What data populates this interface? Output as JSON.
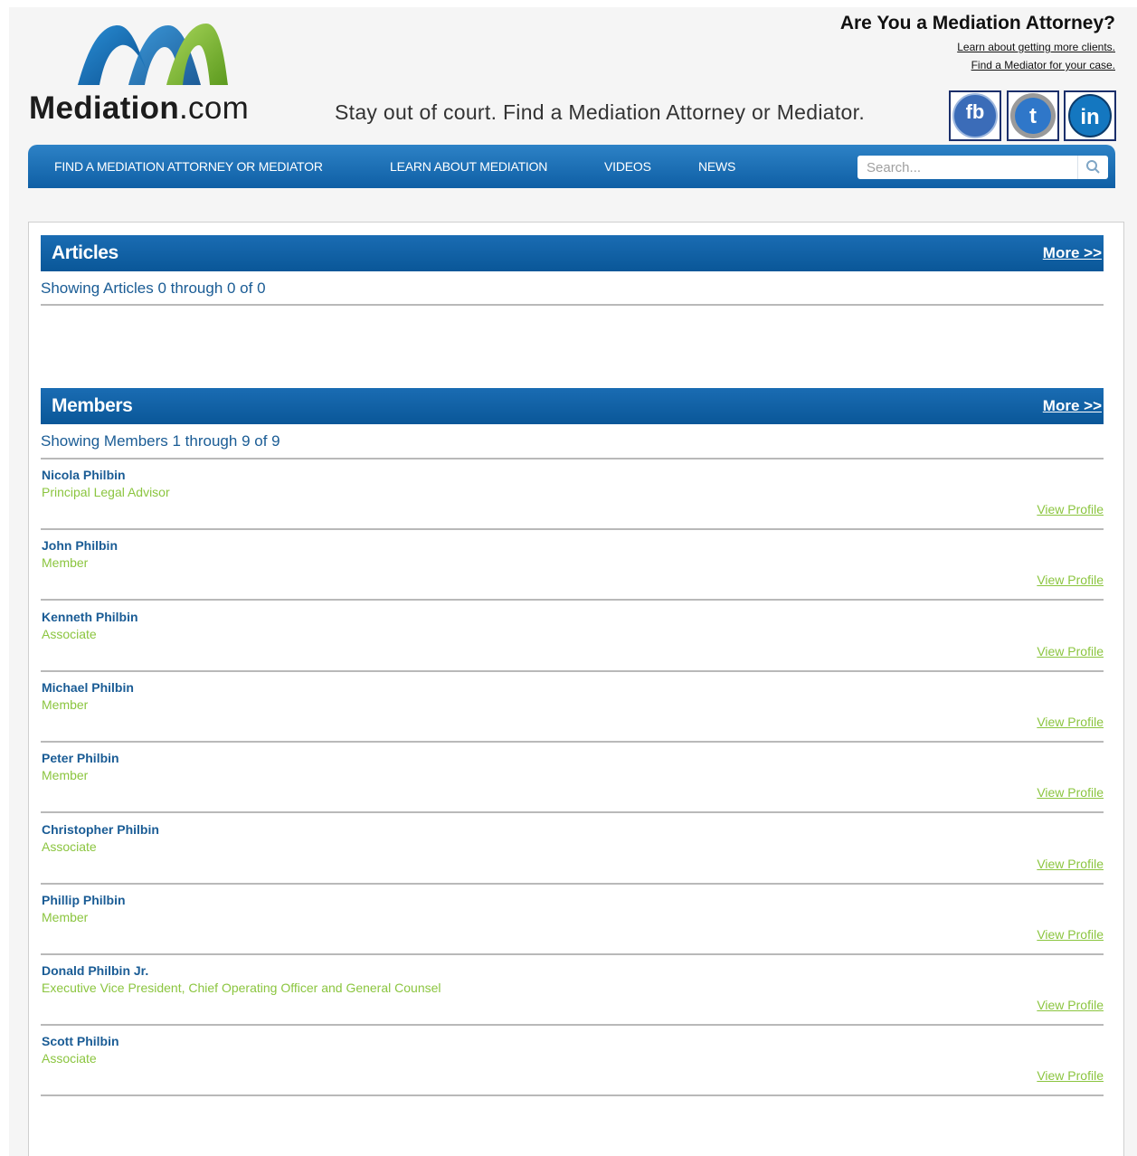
{
  "header": {
    "logo_bold": "Mediation",
    "logo_light": ".com",
    "tagline": "Stay out of court. Find a Mediation Attorney or Mediator.",
    "promo_title": "Are You a Mediation Attorney?",
    "promo_links": [
      "Learn about getting more clients.",
      "Find a Mediator for your case."
    ],
    "social": [
      "facebook-icon",
      "twitter-icon",
      "linkedin-icon"
    ],
    "brand_blue": "#1a6cb3",
    "brand_green": "#8bc53f"
  },
  "nav": {
    "items": [
      "FIND A MEDIATION ATTORNEY OR MEDIATOR",
      "LEARN ABOUT MEDIATION",
      "VIDEOS",
      "NEWS"
    ],
    "search_placeholder": "Search..."
  },
  "articles": {
    "title": "Articles",
    "more": "More >>",
    "showing": "Showing Articles 0 through 0 of 0"
  },
  "members": {
    "title": "Members",
    "more": "More >>",
    "showing": "Showing Members 1 through 9 of 9",
    "view_label": "View Profile",
    "list": [
      {
        "name": "Nicola Philbin",
        "title": "Principal Legal Advisor"
      },
      {
        "name": "John Philbin",
        "title": "Member"
      },
      {
        "name": "Kenneth Philbin",
        "title": "Associate"
      },
      {
        "name": "Michael Philbin",
        "title": "Member"
      },
      {
        "name": "Peter Philbin",
        "title": "Member"
      },
      {
        "name": "Christopher Philbin",
        "title": "Associate"
      },
      {
        "name": "Phillip Philbin",
        "title": "Member"
      },
      {
        "name": "Donald Philbin Jr.",
        "title": "Executive Vice President, Chief Operating Officer and General Counsel"
      },
      {
        "name": "Scott Philbin",
        "title": "Associate"
      }
    ]
  }
}
